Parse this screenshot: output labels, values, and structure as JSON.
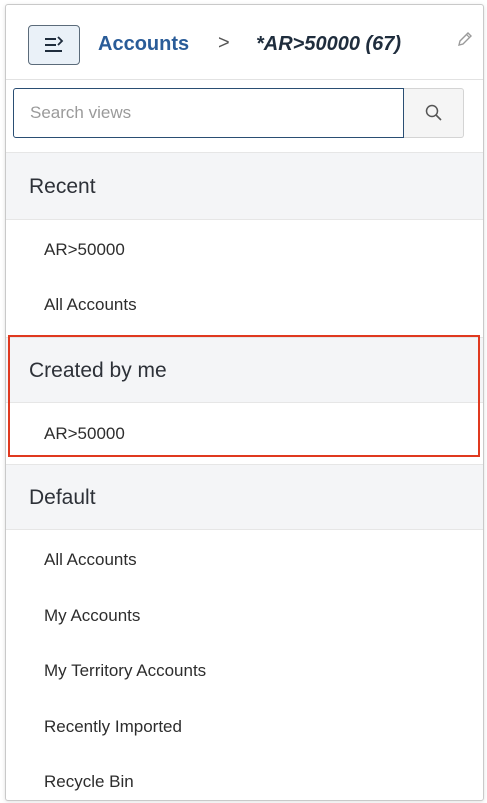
{
  "header": {
    "breadcrumb_link": "Accounts",
    "breadcrumb_separator": ">",
    "current_view": "*AR>50000 (67)",
    "icons": {
      "toggle": "list-toggle-icon",
      "edit": "pencil-icon"
    }
  },
  "search": {
    "placeholder": "Search views",
    "value": "",
    "icon": "search-icon"
  },
  "sections": {
    "recent": {
      "title": "Recent",
      "items": [
        "AR>50000",
        "All Accounts"
      ]
    },
    "created": {
      "title": "Created by me",
      "items": [
        "AR>50000"
      ]
    },
    "default": {
      "title": "Default",
      "items": [
        "All Accounts",
        "My Accounts",
        "My Territory Accounts",
        "Recently Imported",
        "Recycle Bin"
      ]
    }
  },
  "colors": {
    "accent": "#2a5c98",
    "highlight_border": "#e0391f",
    "section_bg": "#f4f5f7"
  }
}
